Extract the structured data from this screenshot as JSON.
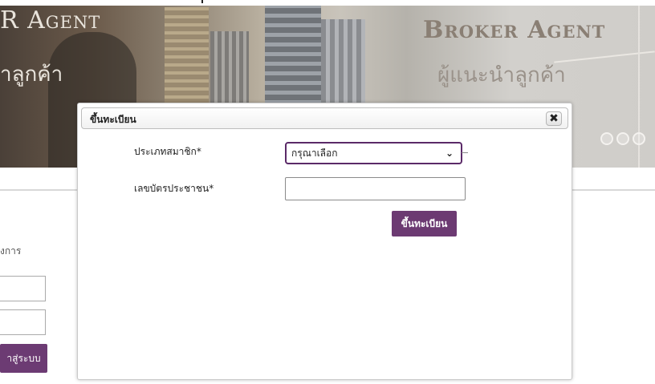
{
  "banner": {
    "left_title": "R Agent",
    "left_subtitle": "าลูกค้า",
    "right_title": "Broker Agent",
    "right_subtitle": "ผู้แนะนำลูกค้า",
    "carousel_dot_count": 3
  },
  "background_form": {
    "section_label": "งการ",
    "login_button": "าสู่ระบบ"
  },
  "modal": {
    "title": "ขึ้นทะเบียน",
    "close_icon": "close-icon",
    "fields": {
      "member_type_label": "ประเภทสมาชิก*",
      "member_type_value": "กรุณาเลือก",
      "id_card_label": "เลขบัตรประชาชน*",
      "id_card_value": ""
    },
    "submit_label": "ขึ้นทะเบียน"
  },
  "colors": {
    "accent": "#6c3a72",
    "select_border": "#5b2a68"
  }
}
